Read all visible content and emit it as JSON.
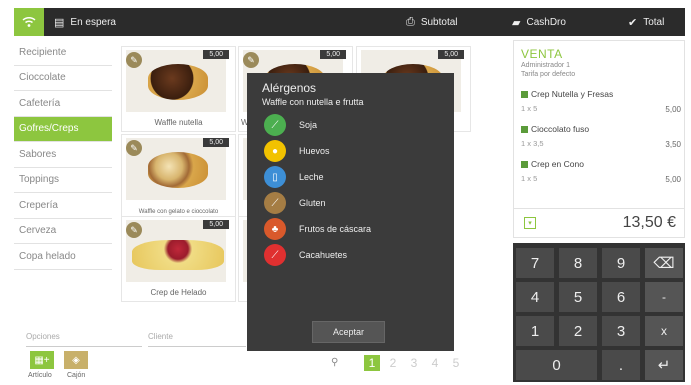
{
  "topbar": {
    "status": "En espera",
    "subtotal": "Subtotal",
    "cashdro": "CashDro",
    "total": "Total"
  },
  "sidebar": {
    "categories": [
      "Recipiente",
      "Cioccolate",
      "Cafetería",
      "Gofres/Creps",
      "Sabores",
      "Toppings",
      "Crepería",
      "Cerveza",
      "Copa helado"
    ],
    "active_index": 3
  },
  "products": [
    {
      "name": "Waffle nutella",
      "price": "5,00"
    },
    {
      "name": "W",
      "price": "5,00"
    },
    {
      "name": "",
      "price": "5,00"
    },
    {
      "name": "Waffle con gelato e cioccolato",
      "price": "5,00"
    },
    {
      "name": "Crep de Helado",
      "price": "5,00"
    }
  ],
  "modal": {
    "title": "Alérgenos",
    "subtitle": "Waffle con nutella e frutta",
    "allergens": [
      {
        "label": "Soja",
        "icon": "soy-icon",
        "color": "#4caf50"
      },
      {
        "label": "Huevos",
        "icon": "egg-icon",
        "color": "#f2c200"
      },
      {
        "label": "Leche",
        "icon": "milk-icon",
        "color": "#3d8fd6"
      },
      {
        "label": "Gluten",
        "icon": "wheat-icon",
        "color": "#a57d44"
      },
      {
        "label": "Frutos de cáscara",
        "icon": "nut-icon",
        "color": "#d9592b"
      },
      {
        "label": "Cacahuetes",
        "icon": "peanut-icon",
        "color": "#e03030"
      }
    ],
    "accept": "Aceptar"
  },
  "ticket": {
    "title": "VENTA",
    "user": "Administrador 1",
    "tariff": "Tarifa por defecto",
    "items": [
      {
        "name": "Crep Nutella y Fresas",
        "qty": "1 x 5",
        "price": "5,00"
      },
      {
        "name": "Cioccolato fuso",
        "qty": "1 x 3,5",
        "price": "3,50"
      },
      {
        "name": "Crep en Cono",
        "qty": "1 x 5",
        "price": "5,00"
      }
    ],
    "total": "13,50 €"
  },
  "keypad": {
    "keys": [
      "7",
      "8",
      "9",
      "⌫",
      "4",
      "5",
      "6",
      "-",
      "1",
      "2",
      "3",
      "x",
      "0",
      ".",
      "↵"
    ]
  },
  "bottom": {
    "options_label": "Opciones",
    "client_label": "Cliente",
    "articulo": "Artículo",
    "cajon": "Cajón",
    "pages": [
      "1",
      "2",
      "3",
      "4",
      "5"
    ],
    "active_page": "1"
  },
  "colors": {
    "accent": "#8dc63f",
    "dark": "#2b2b2b"
  }
}
